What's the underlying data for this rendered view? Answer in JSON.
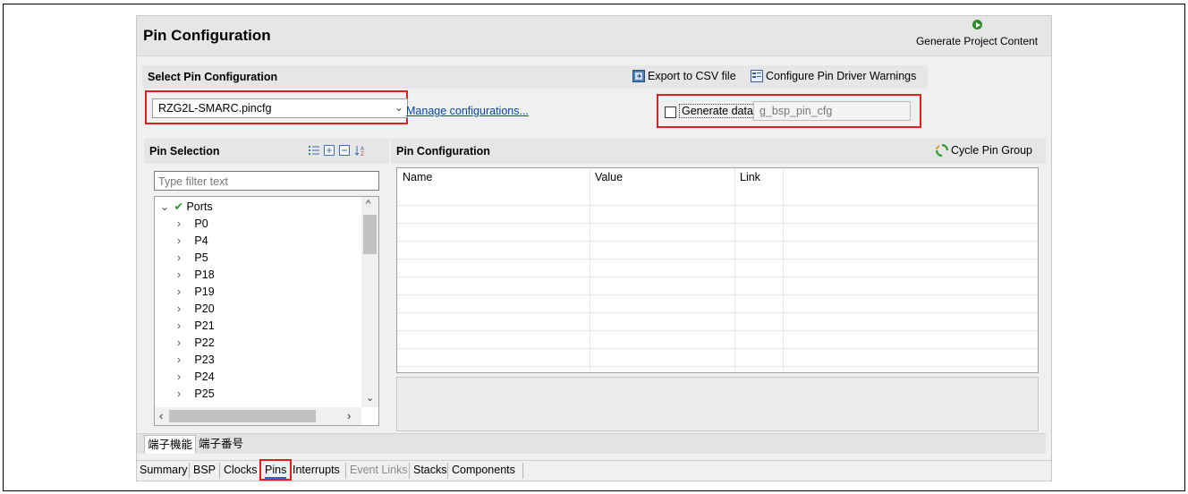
{
  "header": {
    "title": "Pin Configuration",
    "generate_button": "Generate Project Content"
  },
  "select_section": {
    "title": "Select Pin Configuration",
    "export_csv": "Export to CSV file",
    "configure_warnings": "Configure Pin Driver Warnings",
    "config_value": "RZG2L-SMARC.pincfg",
    "manage_link": "Manage configurations...",
    "generate_data_label": "Generate data:",
    "generate_data_checked": false,
    "generate_data_value": "g_bsp_pin_cfg"
  },
  "pin_selection": {
    "title": "Pin Selection",
    "filter_placeholder": "Type filter text",
    "root": "Ports",
    "items": [
      "P0",
      "P4",
      "P5",
      "P18",
      "P19",
      "P20",
      "P21",
      "P22",
      "P23",
      "P24",
      "P25"
    ]
  },
  "pin_configuration": {
    "title": "Pin Configuration",
    "cycle_button": "Cycle Pin Group",
    "columns": [
      "Name",
      "Value",
      "Link"
    ]
  },
  "lower_tabs": [
    "端子機能",
    "端子番号"
  ],
  "bottom_tabs": [
    "Summary",
    "BSP",
    "Clocks",
    "Pins",
    "Interrupts",
    "Event Links",
    "Stacks",
    "Components"
  ],
  "active_bottom_tab": "Pins",
  "colors": {
    "highlight_red": "#e02020",
    "active_tab_underline": "#1a6fd4",
    "link_blue": "#0645ad"
  }
}
